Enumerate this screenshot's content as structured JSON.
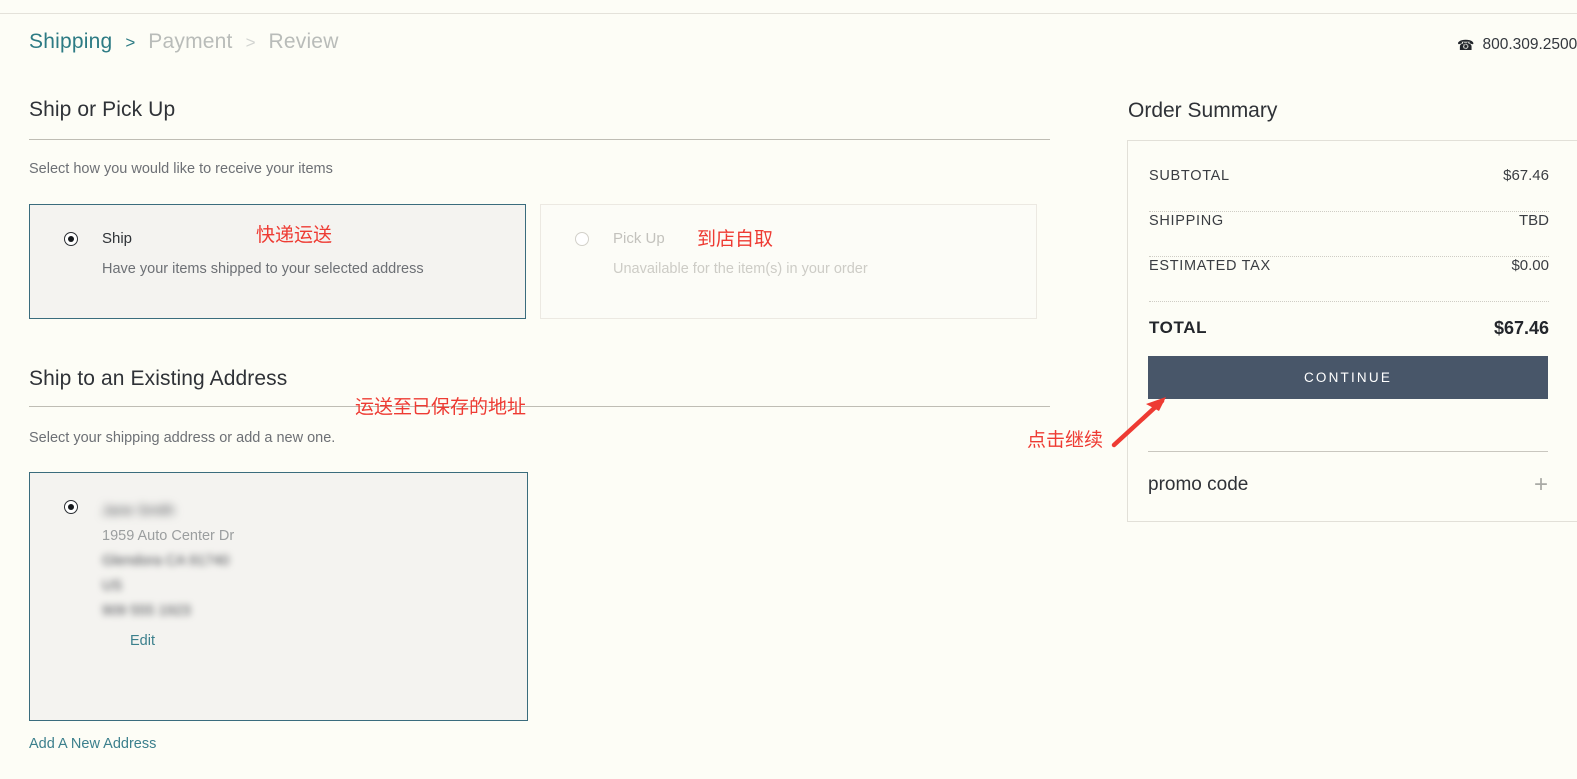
{
  "header": {
    "breadcrumbs": [
      {
        "label": "Shipping",
        "state": "active"
      },
      {
        "label": "Payment",
        "state": "inactive"
      },
      {
        "label": "Review",
        "state": "inactive"
      }
    ],
    "separator": ">",
    "phone_icon": "phone-icon",
    "phone_number": "800.309.2500"
  },
  "fulfillment": {
    "title": "Ship or Pick Up",
    "subtitle": "Select how you would like to receive your items",
    "options": [
      {
        "label": "Ship",
        "description": "Have your items shipped to your selected address",
        "selected": true,
        "annotation": "快递运送"
      },
      {
        "label": "Pick Up",
        "description": "Unavailable for the item(s) in your order",
        "selected": false,
        "annotation": "到店自取"
      }
    ]
  },
  "address_section": {
    "title": "Ship to an Existing Address",
    "subtitle": "Select your shipping address or add a new one.",
    "annotation": "运送至已保存的地址",
    "saved_address": {
      "selected": true,
      "lines": [
        "Jane Smith",
        "1959 Auto Center Dr",
        "Glendora CA 91740",
        "US",
        "909 555 1923"
      ],
      "edit_label": "Edit"
    },
    "add_new_label": "Add A New Address"
  },
  "order_summary": {
    "title": "Order Summary",
    "rows": [
      {
        "label": "SUBTOTAL",
        "value": "$67.46"
      },
      {
        "label": "SHIPPING",
        "value": "TBD"
      },
      {
        "label": "ESTIMATED TAX",
        "value": "$0.00"
      }
    ],
    "total": {
      "label": "TOTAL",
      "value": "$67.46"
    },
    "continue_label": "CONTINUE",
    "continue_annotation": "点击继续",
    "promo": {
      "label": "promo code",
      "toggle_icon": "plus-icon"
    }
  },
  "colors": {
    "page_background": "#fdfdf6",
    "accent_teal": "#2d7b84",
    "link_teal": "#3b7f8c",
    "selected_border": "#3a6c7d",
    "card_background": "#f4f3f0",
    "button_slate": "#485669",
    "annotation_red": "#ee3b33",
    "muted_text": "#6d7075",
    "disabled_text": "#c3c2bd"
  }
}
